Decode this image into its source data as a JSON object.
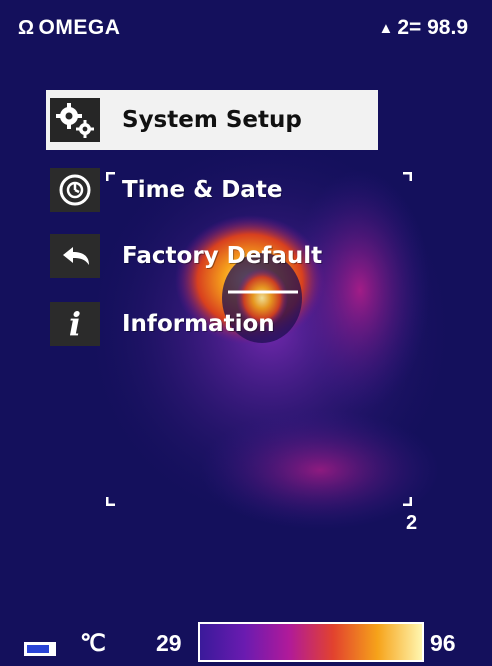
{
  "header": {
    "brand_mark": "Ω",
    "brand_name": "OMEGA",
    "readout_icon": "triangle-marker-icon",
    "readout_text": "2= 98.9"
  },
  "menu": {
    "items": [
      {
        "icon": "gears-icon",
        "label": "System Setup",
        "selected": true
      },
      {
        "icon": "clock-icon",
        "label": "Time & Date",
        "selected": false
      },
      {
        "icon": "return-arrow-icon",
        "label": "Factory Default",
        "selected": false
      },
      {
        "icon": "info-icon",
        "icon_glyph": "i",
        "label": "Information",
        "selected": false
      }
    ]
  },
  "overlay": {
    "marker_label": "2"
  },
  "footer": {
    "battery_icon": "battery-icon",
    "unit": "℃",
    "scale_min": "29",
    "scale_max": "96"
  },
  "colors": {
    "background": "#14105c",
    "selected_bg": "#f2f2f2",
    "palette": [
      "#3a1a9a",
      "#6a1bb0",
      "#b01a9a",
      "#e2422e",
      "#f6a31a",
      "#fff6b0"
    ]
  }
}
